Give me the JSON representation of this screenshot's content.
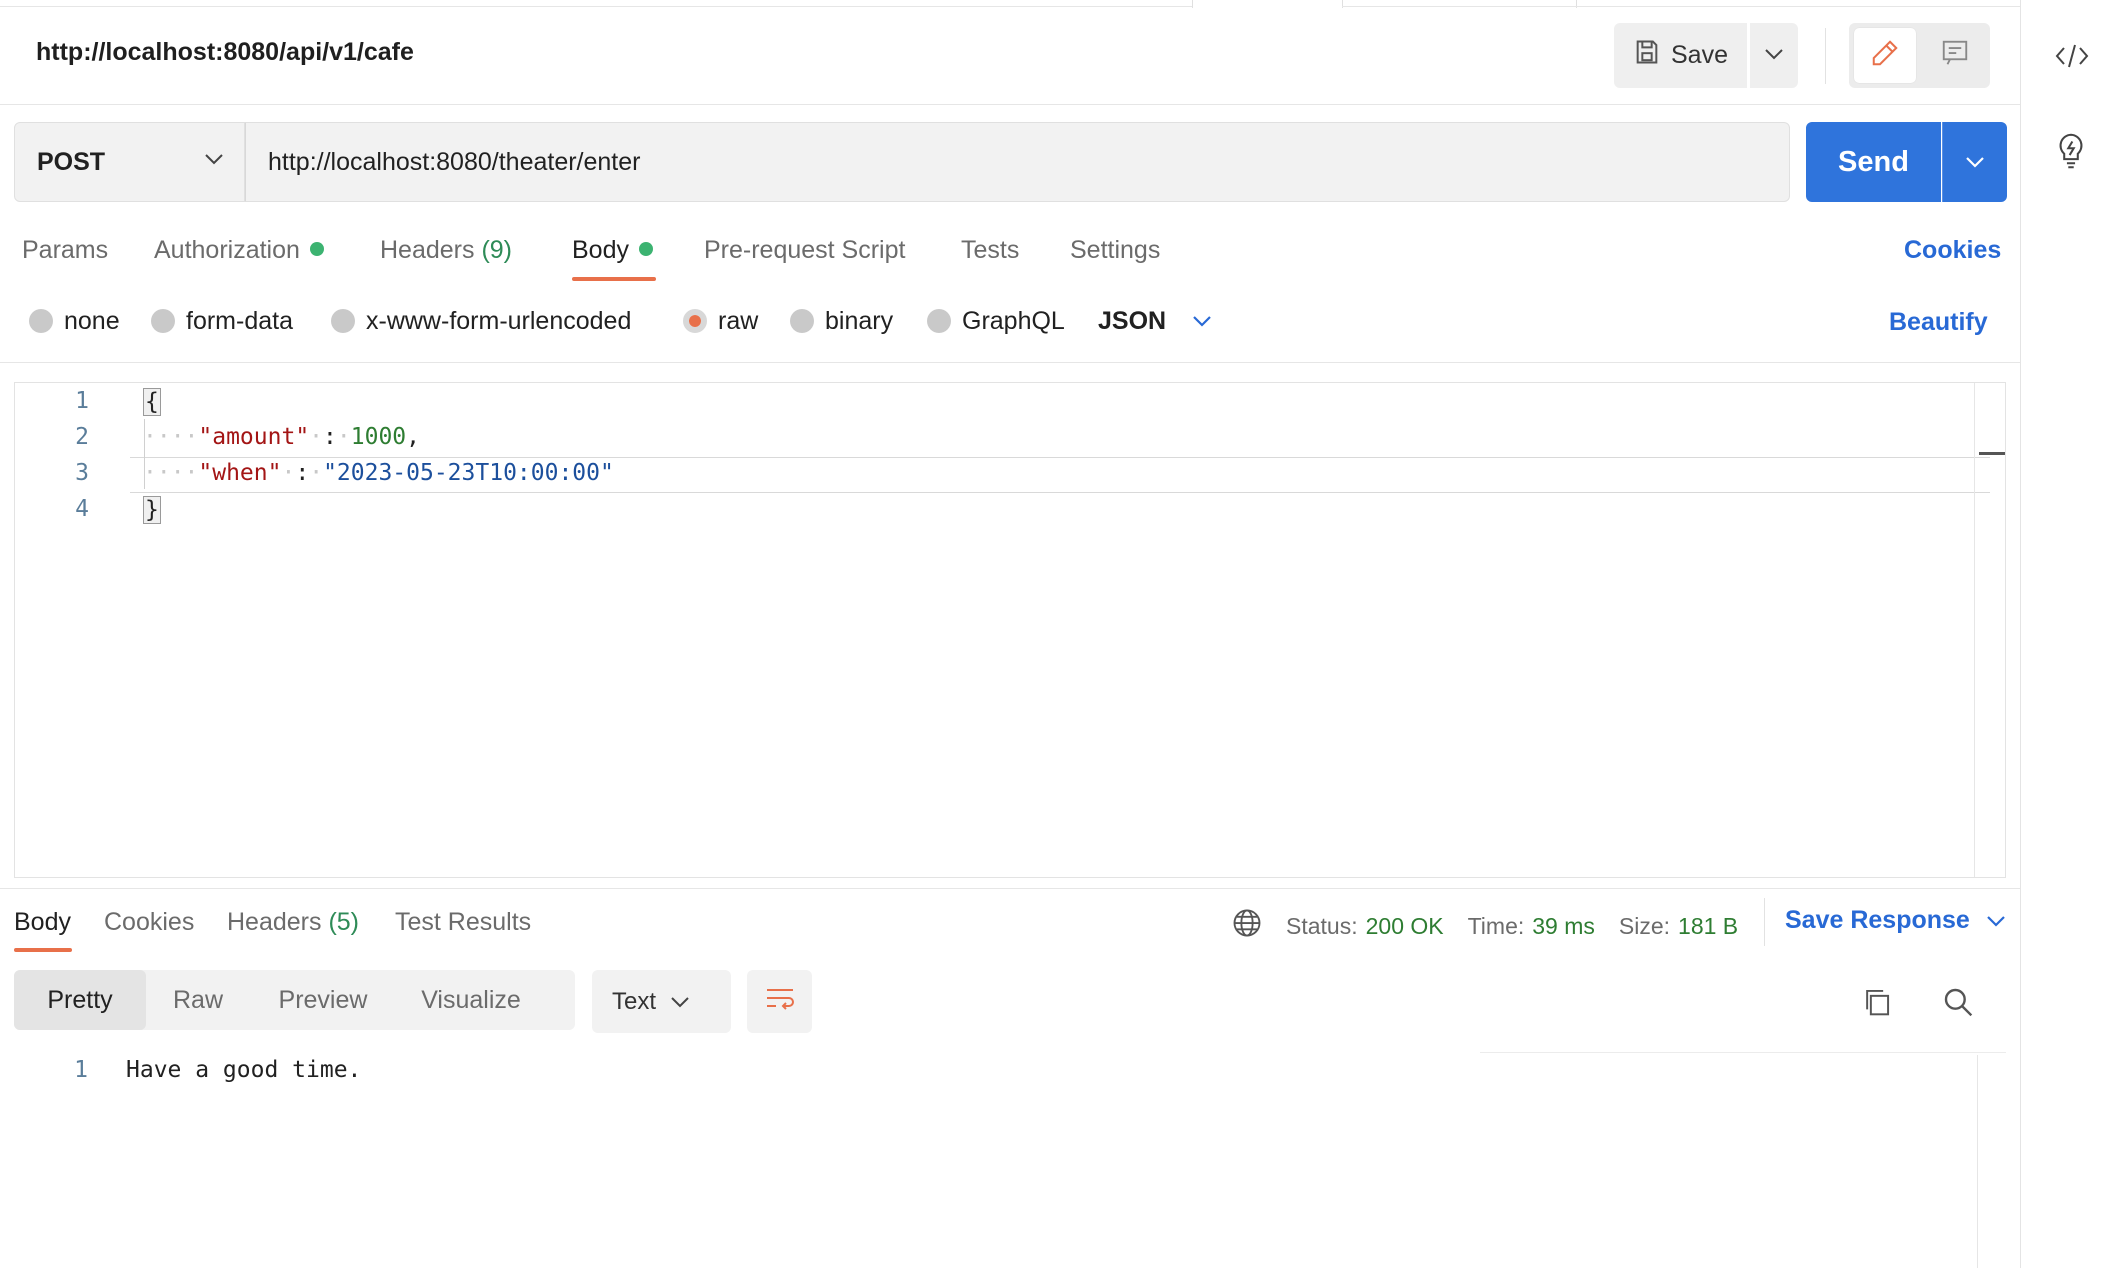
{
  "header": {
    "request_title": "http://localhost:8080/api/v1/cafe",
    "save_label": "Save"
  },
  "request": {
    "method": "POST",
    "url": "http://localhost:8080/theater/enter",
    "send_label": "Send"
  },
  "request_tabs": {
    "params": "Params",
    "authorization": "Authorization",
    "headers": "Headers",
    "headers_count": "(9)",
    "body": "Body",
    "prerequest": "Pre-request Script",
    "tests": "Tests",
    "settings": "Settings",
    "cookies": "Cookies"
  },
  "body_options": {
    "none": "none",
    "form_data": "form-data",
    "urlencoded": "x-www-form-urlencoded",
    "raw": "raw",
    "binary": "binary",
    "graphql": "GraphQL",
    "language": "JSON",
    "beautify": "Beautify",
    "selected": "raw"
  },
  "editor": {
    "line_numbers": [
      "1",
      "2",
      "3",
      "4"
    ],
    "open_brace": "{",
    "close_brace": "}",
    "key_amount": "\"amount\"",
    "val_amount": "1000",
    "key_when": "\"when\"",
    "val_when": "\"2023-05-23T10:00:00\"",
    "colon": ":",
    "comma": ",",
    "indent_dots": "····"
  },
  "response_tabs": {
    "body": "Body",
    "cookies": "Cookies",
    "headers": "Headers",
    "headers_count": "(5)",
    "test_results": "Test Results"
  },
  "response_status": {
    "status_label": "Status:",
    "status_value": "200 OK",
    "time_label": "Time:",
    "time_value": "39 ms",
    "size_label": "Size:",
    "size_value": "181 B",
    "save_response": "Save Response"
  },
  "response_view": {
    "pretty": "Pretty",
    "raw": "Raw",
    "preview": "Preview",
    "visualize": "Visualize",
    "format": "Text"
  },
  "response_body": {
    "line_number": "1",
    "text": "Have a good time."
  },
  "colors": {
    "accent_orange": "#e8704a",
    "send_blue": "#2f74dc",
    "link_blue": "#2869d5",
    "status_green": "#2e7d32"
  },
  "icons": [
    "save-icon",
    "chevron-down-icon",
    "pencil-icon",
    "comment-icon",
    "code-icon",
    "lightbulb-icon",
    "globe-icon",
    "wrap-lines-icon",
    "copy-icon",
    "search-icon"
  ]
}
